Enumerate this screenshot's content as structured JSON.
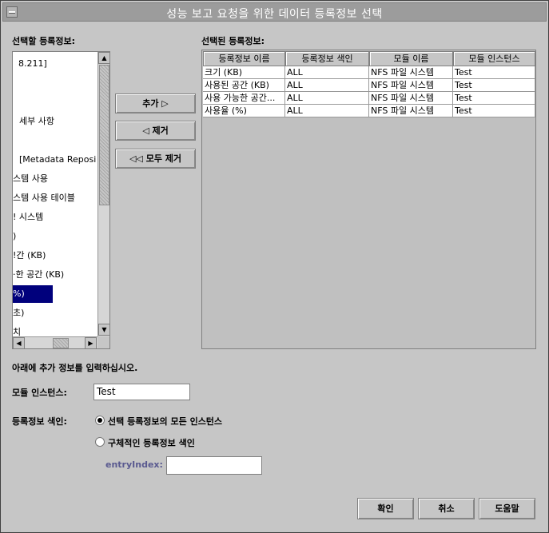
{
  "window": {
    "title": "성능 보고 요청을 위한 데이터 등록정보 선택"
  },
  "available": {
    "label": "선택할 등록정보:",
    "items": [
      "8.211]",
      "",
      "",
      "세부 사항",
      "",
      "[Metadata Reposi",
      "스템 사용",
      "스템 사용 테이블",
      "! 시스템",
      ")",
      "!간 (KB)",
      "·한 공간 (KB)",
      "%)",
      "초)",
      "치"
    ],
    "selected_index": 12
  },
  "buttons": {
    "add": "추가 ▷",
    "remove": "◁ 제거",
    "remove_all": "◁◁ 모두 제거",
    "ok": "확인",
    "cancel": "취소",
    "help": "도움말"
  },
  "selected": {
    "label": "선택된 등록정보:",
    "columns": [
      "등록정보 이름",
      "등록정보 색인",
      "모듈 이름",
      "모듈 인스턴스"
    ],
    "rows": [
      [
        "크기 (KB)",
        "ALL",
        "NFS 파일 시스템",
        "Test"
      ],
      [
        "사용된 공간 (KB)",
        "ALL",
        "NFS 파일 시스템",
        "Test"
      ],
      [
        "사용 가능한 공간...",
        "ALL",
        "NFS 파일 시스템",
        "Test"
      ],
      [
        "사용율 (%)",
        "ALL",
        "NFS 파일 시스템",
        "Test"
      ]
    ]
  },
  "extra": {
    "instruction": "아래에 추가 정보를 입력하십시오.",
    "module_instance_label": "모듈 인스턴스:",
    "module_instance_value": "Test",
    "index_label": "등록정보 색인:",
    "radio_all": "선택 등록정보의 모든 인스턴스",
    "radio_specific": "구체적인 등록정보 색인",
    "entry_index_label": "entryIndex:",
    "entry_index_value": ""
  }
}
